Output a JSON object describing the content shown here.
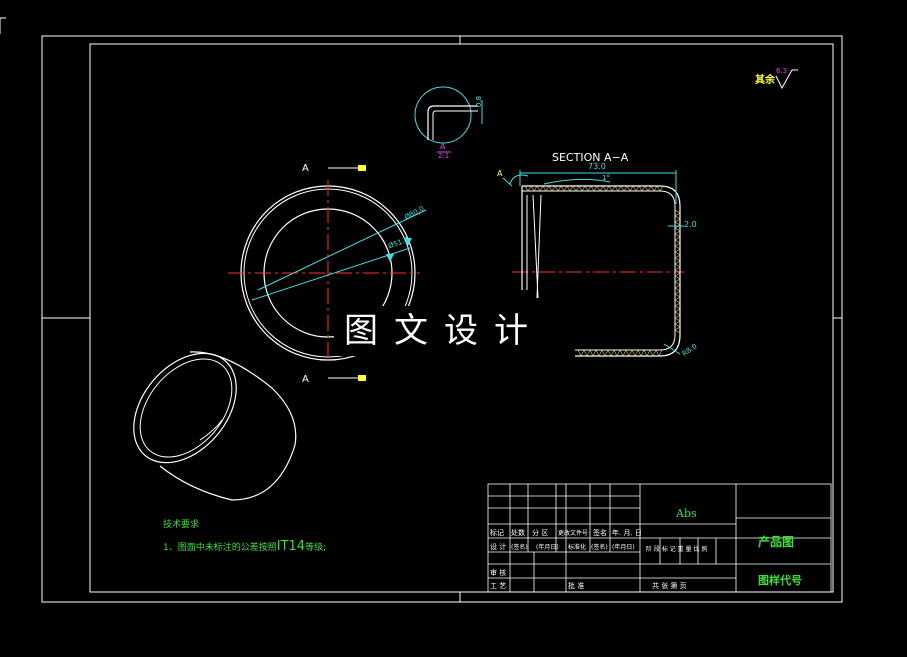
{
  "drawing": {
    "section_title": "SECTION A−A",
    "section_mark": "A",
    "section_mark_top": "A",
    "section_mark_bottom": "A",
    "detail_label": "A",
    "detail_scale": "2:1",
    "detail_dim": "0.8",
    "dim_length": "73.0",
    "dim_angle": "1°",
    "dim_thickness": "2.0",
    "dim_radius": "R8.0",
    "dim_dia_outer": "Ø80.0",
    "dim_dia_inner": "Ø51.8",
    "roughness_label": "其余",
    "roughness_value": "6.3",
    "watermark": "图文设计"
  },
  "notes": {
    "heading": "技术要求",
    "line1_prefix": "1、图面中未标注的公差按照",
    "line1_grade": "IT14",
    "line1_suffix": "等级;"
  },
  "title_block": {
    "material": "Abs",
    "product_name": "产品图",
    "drawing_code": "图样代号",
    "row_a": [
      "标记",
      "处数",
      "分 区",
      "更改文件号",
      "签名",
      "年. 月. 日"
    ],
    "row_b": [
      "设 计",
      "(签名)",
      "(年月日)",
      "标准化",
      "(签名)",
      "(年月日)"
    ],
    "row_b_right": "阶 段 标 记   重 量   比 例",
    "row_c": [
      "审 核"
    ],
    "row_d": [
      "工 艺",
      "批 准"
    ],
    "row_d_right": "共   张   第   页"
  },
  "colors": {
    "line": "#ffffff",
    "center": "#ff3030",
    "dimension": "#40e0e0",
    "text_green": "#3adf3a",
    "mark_yellow": "#ffff40",
    "magenta": "#e040e0"
  }
}
